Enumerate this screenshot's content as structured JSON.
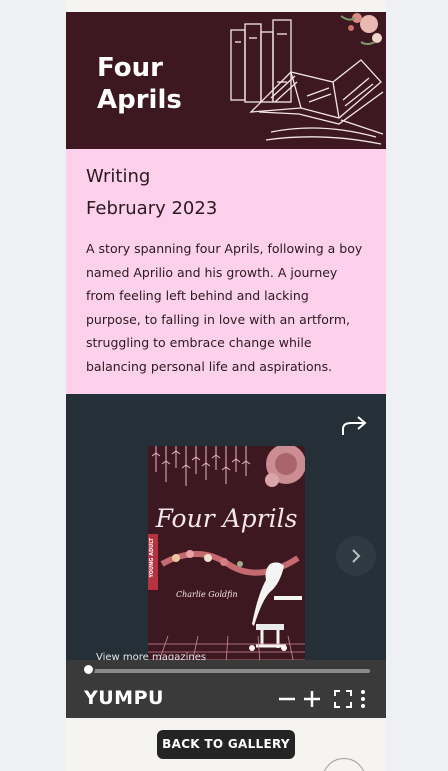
{
  "hero": {
    "title": "Four Aprils"
  },
  "info": {
    "category": "Writing",
    "date": "February 2023",
    "description": "A story spanning four Aprils, following a boy named Aprilio and his growth. A journey from feeling left behind and lacking purpose, to falling in love with an artform, struggling to embrace change while balancing personal life and aspirations."
  },
  "viewer": {
    "cover_title": "Four Aprils",
    "cover_author": "Charlie Goldfin",
    "cover_tab": "YOUNG ADULT",
    "view_more": "View more magazines",
    "progress": 0
  },
  "toolbar": {
    "brand": "YUMPU",
    "icons": [
      "zoom-out-icon",
      "zoom-in-icon",
      "fullscreen-icon",
      "more-vertical-icon"
    ]
  },
  "gallery_button": "BACK TO GALLERY",
  "colors": {
    "hero_bg": "#3e1820",
    "info_bg": "#fdd0eb",
    "viewer_bg": "#242f37",
    "toolbar_bg": "#3a3a3a"
  }
}
